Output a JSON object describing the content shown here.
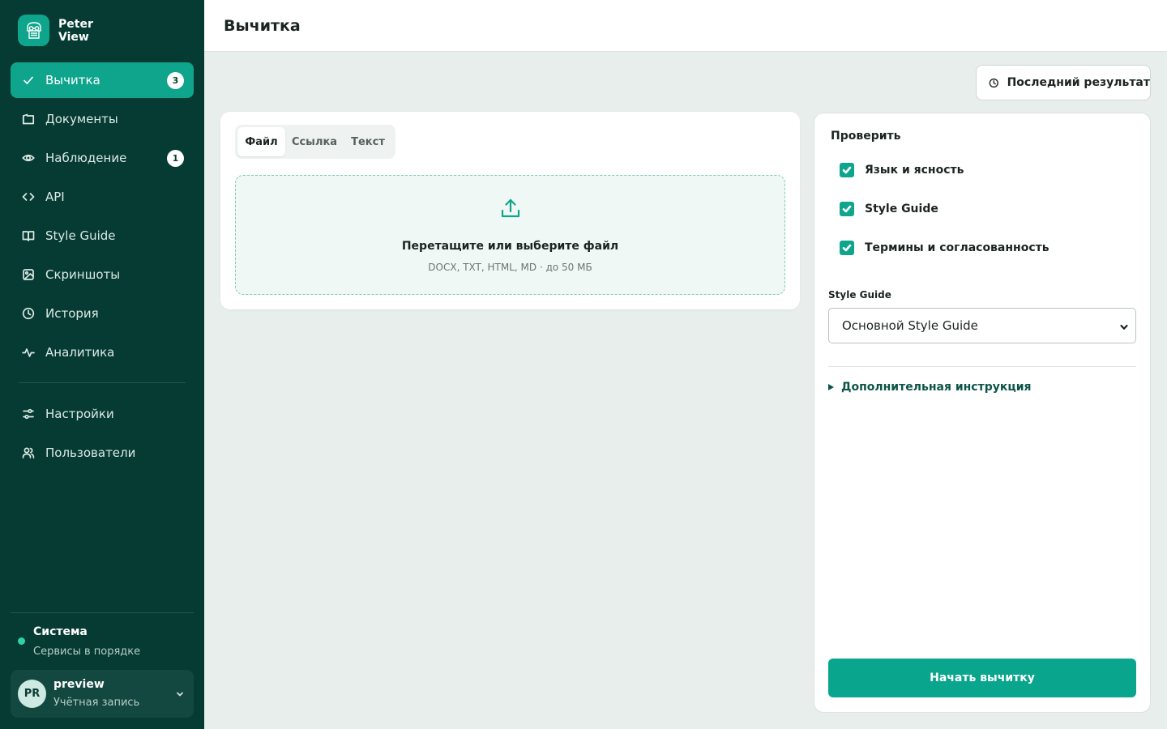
{
  "brand": {
    "line1": "Peter",
    "line2": "View"
  },
  "sidebar": {
    "items": [
      {
        "label": "Вычитка",
        "icon": "check-icon",
        "badge": "3",
        "active": true
      },
      {
        "label": "Документы",
        "icon": "folder-icon"
      },
      {
        "label": "Наблюдение",
        "icon": "eye-icon",
        "badge": "1"
      },
      {
        "label": "API",
        "icon": "code-icon"
      },
      {
        "label": "Style Guide",
        "icon": "book-icon"
      },
      {
        "label": "Скриншоты",
        "icon": "image-icon"
      },
      {
        "label": "История",
        "icon": "clock-icon"
      },
      {
        "label": "Аналитика",
        "icon": "activity-icon"
      }
    ],
    "bottom_items": [
      {
        "label": "Настройки",
        "icon": "sliders-icon"
      },
      {
        "label": "Пользователи",
        "icon": "users-icon"
      }
    ],
    "system": {
      "title": "Система",
      "status": "Сервисы в порядке",
      "status_color": "#2ed3a6"
    },
    "account": {
      "initials": "PR",
      "name": "preview",
      "subtitle": "Учётная запись"
    }
  },
  "header": {
    "title": "Вычитка"
  },
  "toolbar": {
    "last_result_label": "Последний результат"
  },
  "upload": {
    "tabs": [
      {
        "label": "Файл",
        "active": true
      },
      {
        "label": "Ссылка"
      },
      {
        "label": "Текст"
      }
    ],
    "dropzone": {
      "title": "Перетащите или выберите файл",
      "subtitle": "DOCX, TXT, HTML, MD · до 50 МБ"
    }
  },
  "checks": {
    "title": "Проверить",
    "options": [
      {
        "label": "Язык и ясность",
        "checked": true
      },
      {
        "label": "Style Guide",
        "checked": true
      },
      {
        "label": "Термины и согласованность",
        "checked": true
      }
    ],
    "style_guide_label": "Style Guide",
    "style_guide_value": "Основной Style Guide",
    "extra_instruction": "Дополнительная инструкция",
    "start_label": "Начать вычитку"
  },
  "colors": {
    "sidebar_bg": "#053b33",
    "accent": "#0fa58d",
    "page_bg": "#e8eeec"
  }
}
